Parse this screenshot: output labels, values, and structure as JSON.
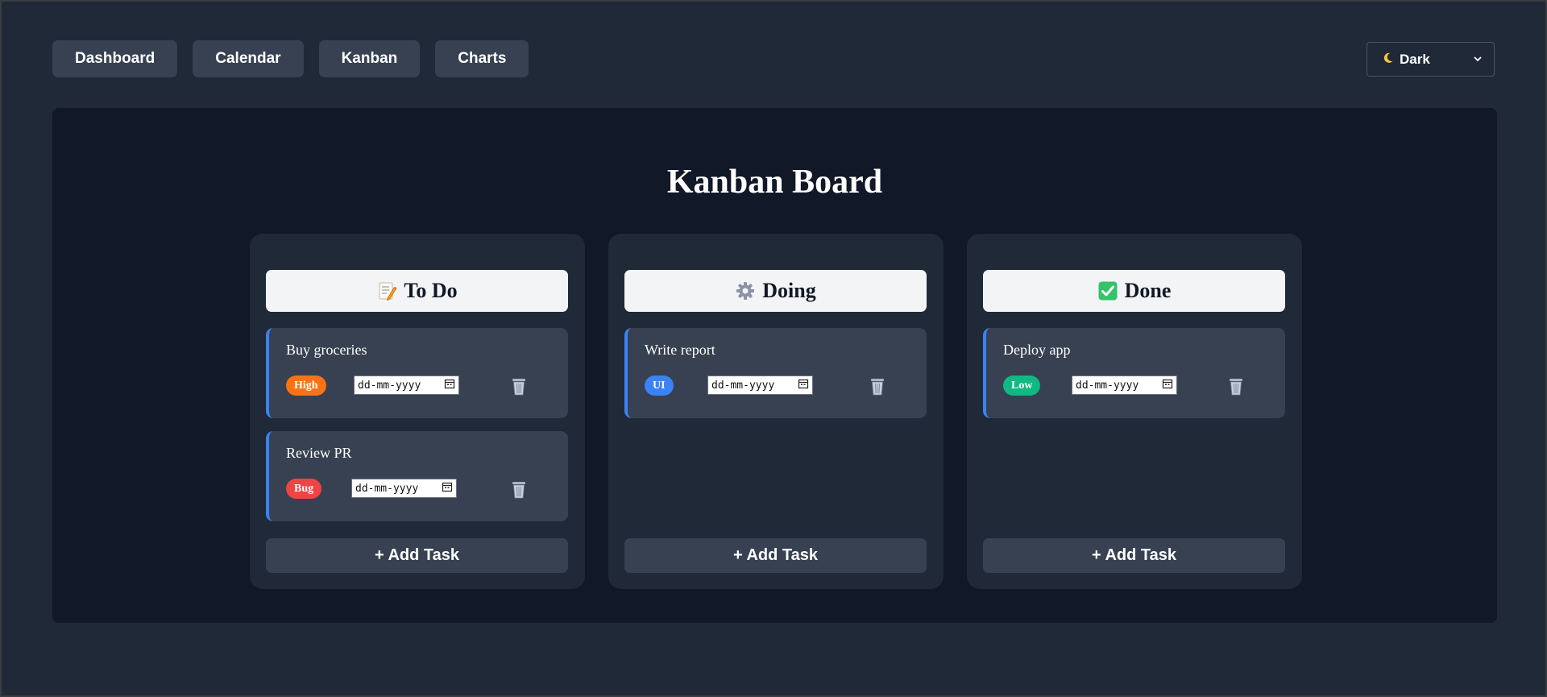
{
  "nav": {
    "items": [
      {
        "label": "Dashboard"
      },
      {
        "label": "Calendar"
      },
      {
        "label": "Kanban"
      },
      {
        "label": "Charts"
      }
    ]
  },
  "theme": {
    "selected": "Dark",
    "icon": "moon-icon"
  },
  "board": {
    "title": "Kanban Board",
    "columns": [
      {
        "title": "To Do",
        "icon": "memo-icon",
        "add_label": "+ Add Task",
        "tasks": [
          {
            "title": "Buy groceries",
            "tag": "High",
            "tag_color": "#f97316",
            "date_placeholder": "dd-mm-yyyy",
            "accent": "#3b82f6"
          },
          {
            "title": "Review PR",
            "tag": "Bug",
            "tag_color": "#ef4444",
            "date_placeholder": "dd-mm-yyyy",
            "accent": "#3b82f6"
          }
        ]
      },
      {
        "title": "Doing",
        "icon": "gear-icon",
        "add_label": "+ Add Task",
        "tasks": [
          {
            "title": "Write report",
            "tag": "UI",
            "tag_color": "#3b82f6",
            "date_placeholder": "dd-mm-yyyy",
            "accent": "#3b82f6"
          }
        ]
      },
      {
        "title": "Done",
        "icon": "check-box-icon",
        "add_label": "+ Add Task",
        "tasks": [
          {
            "title": "Deploy app",
            "tag": "Low",
            "tag_color": "#10b981",
            "date_placeholder": "dd-mm-yyyy",
            "accent": "#3b82f6"
          }
        ]
      }
    ]
  },
  "colors": {
    "page_bg": "#1f2937",
    "board_bg": "#111827",
    "column_bg": "#1f2937",
    "card_bg": "#374151",
    "header_bg": "#f3f4f6"
  }
}
